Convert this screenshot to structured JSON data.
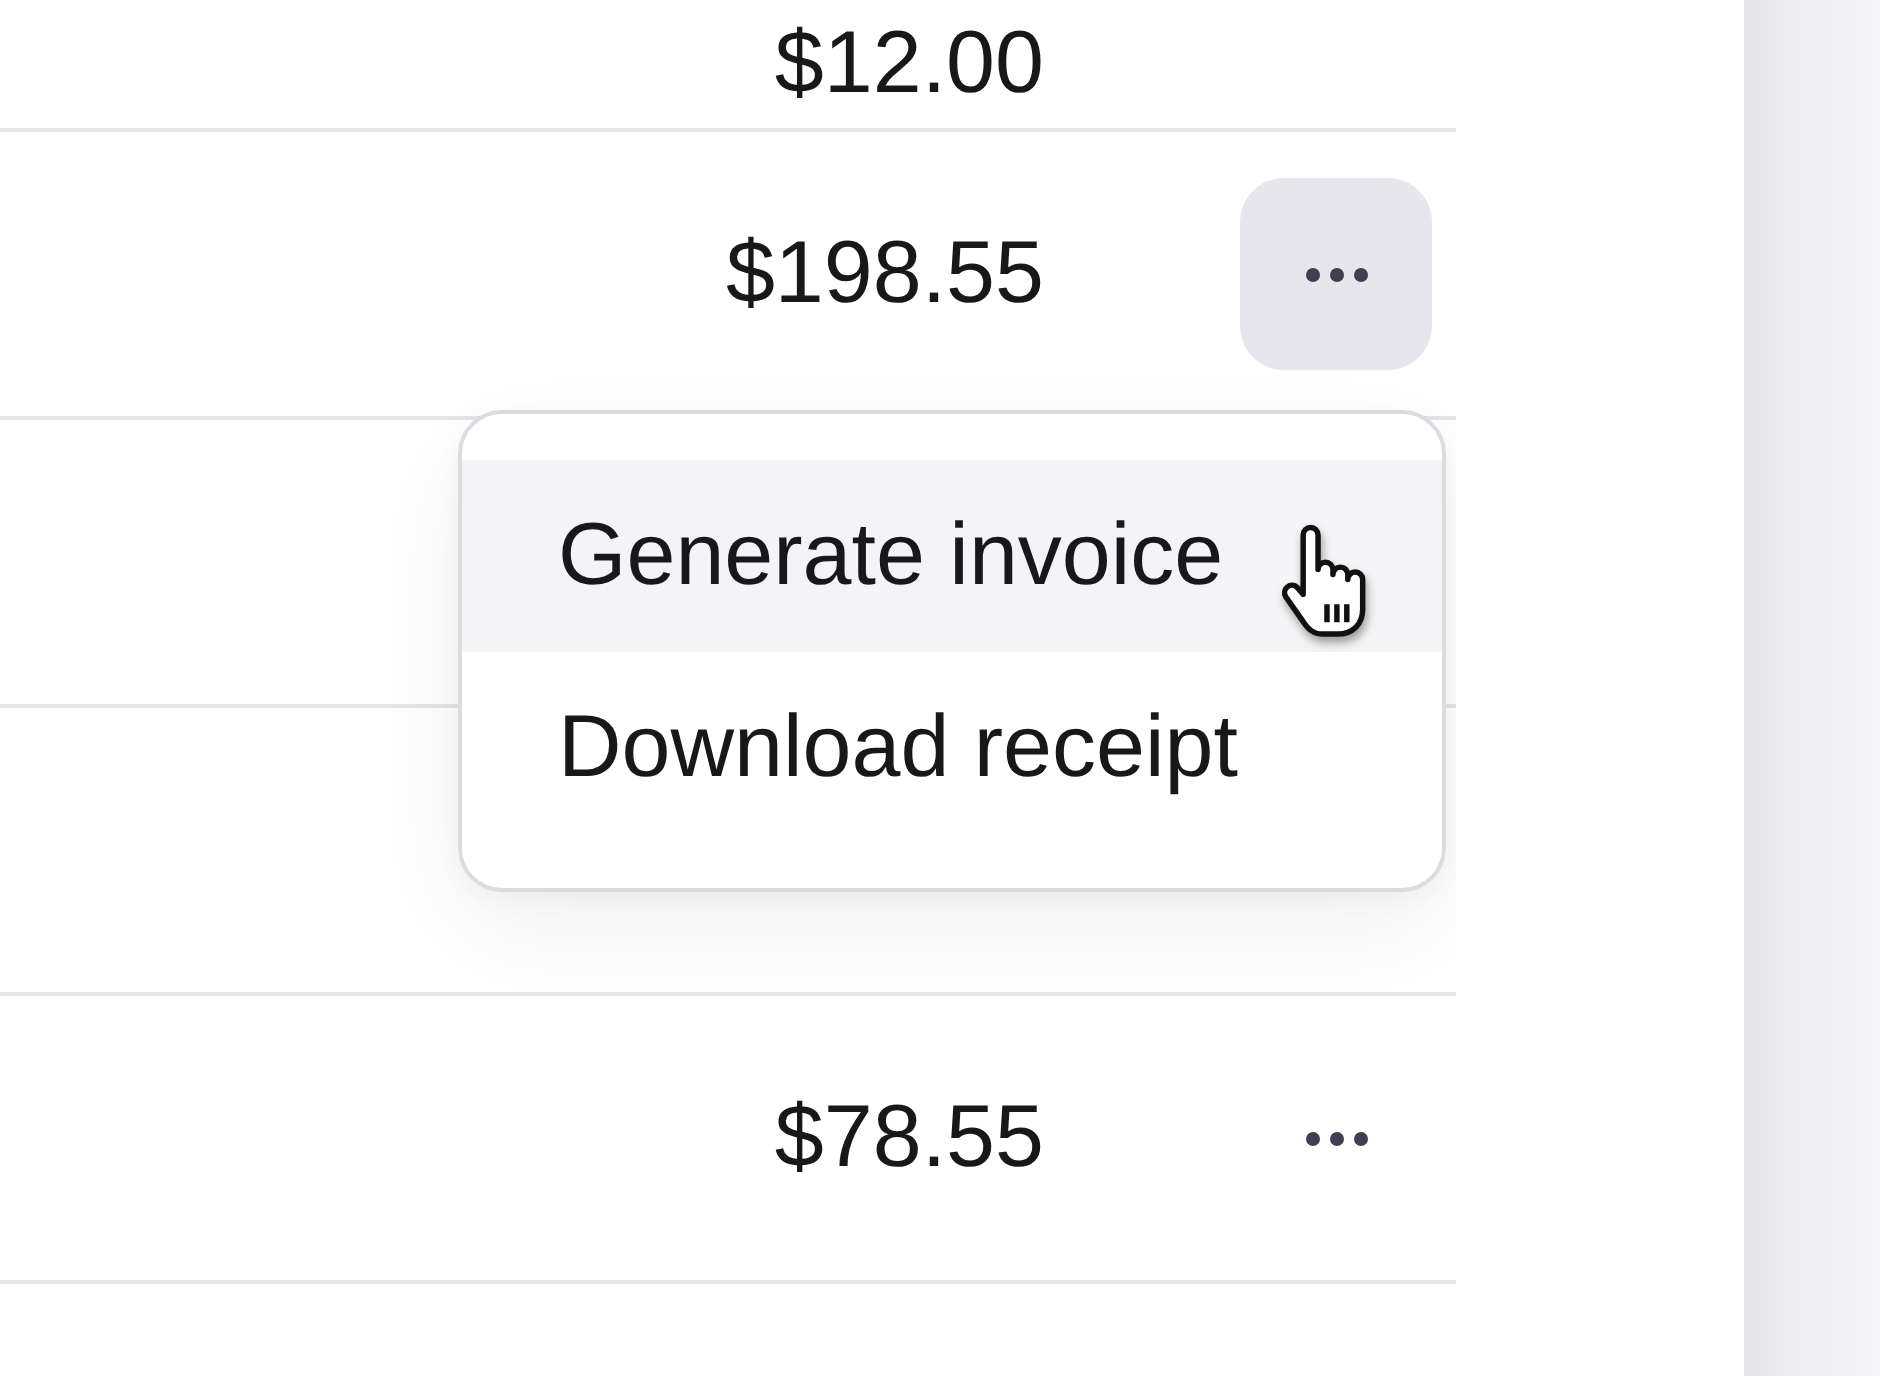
{
  "table": {
    "rows": [
      {
        "amount": "$12.00"
      },
      {
        "amount": "$198.55",
        "more_button": {
          "hovered": true
        }
      },
      {},
      {},
      {
        "amount": "$78.55",
        "more_button": {
          "hovered": false
        }
      },
      {}
    ]
  },
  "context_menu": {
    "items": [
      {
        "label": "Generate invoice",
        "highlighted": true
      },
      {
        "label": "Download receipt",
        "highlighted": false
      }
    ]
  }
}
